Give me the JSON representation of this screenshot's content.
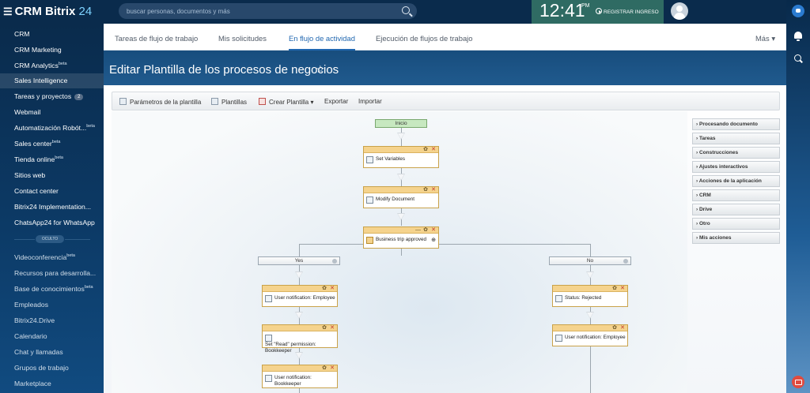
{
  "topbar": {
    "logo_text": "CRM Bitrix",
    "logo_num": "24",
    "search_placeholder": "buscar personas, documentos y más",
    "clock": "12:41",
    "ampm": "PM",
    "checkin_label": "REGISTRAR INGRESO"
  },
  "sidebar": {
    "items": [
      {
        "label": "CRM"
      },
      {
        "label": "CRM Marketing"
      },
      {
        "label": "CRM Analytics",
        "sup": "beta"
      },
      {
        "label": "Sales Intelligence"
      },
      {
        "label": "Tareas y proyectos",
        "badge": "2"
      },
      {
        "label": "Webmail"
      },
      {
        "label": "Automatización Robót...",
        "sup": "beta"
      },
      {
        "label": "Sales center",
        "sup": "beta"
      },
      {
        "label": "Tienda online",
        "sup": "beta"
      },
      {
        "label": "Sitios web"
      },
      {
        "label": "Contact center"
      },
      {
        "label": "Bitrix24 Implementation..."
      },
      {
        "label": "ChatsApp24 for WhatsApp"
      }
    ],
    "separator_label": "OCULTO",
    "hidden_items": [
      {
        "label": "Videoconferencia",
        "sup": "beta"
      },
      {
        "label": "Recursos para desarrolla..."
      },
      {
        "label": "Base de conocimientos",
        "sup": "beta"
      },
      {
        "label": "Empleados"
      },
      {
        "label": "Bitrix24.Drive"
      },
      {
        "label": "Calendario"
      },
      {
        "label": "Chat y llamadas"
      },
      {
        "label": "Grupos de trabajo"
      },
      {
        "label": "Marketplace"
      }
    ]
  },
  "tabs": [
    {
      "label": "Tareas de flujo de trabajo"
    },
    {
      "label": "Mis solicitudes"
    },
    {
      "label": "En flujo de actividad"
    },
    {
      "label": "Ejecución de flujos de trabajo"
    },
    {
      "label": "Más"
    }
  ],
  "page_title": "Editar Plantilla de los procesos de negocios",
  "toolbar": {
    "params": "Parámetros de la plantilla",
    "templates": "Plantillas",
    "create": "Crear Plantilla",
    "export": "Exportar",
    "import": "Importar"
  },
  "flow": {
    "start": "Inicio",
    "set_vars": "Set Variables",
    "modify_doc": "Modify Document",
    "condition": "Business trip approved",
    "branch_yes": "Yes",
    "branch_no": "No",
    "yes_1": "User notification: Employee",
    "yes_2": "Set \"Read\" permission: Bookkeeper",
    "yes_3": "User notification: Bookkeeper",
    "no_1": "Status: Rejected",
    "no_2": "User notification: Employee"
  },
  "activities": [
    {
      "label": "Procesando documento"
    },
    {
      "label": "Tareas"
    },
    {
      "label": "Construcciones"
    },
    {
      "label": "Ajustes interactivos"
    },
    {
      "label": "Acciones de la aplicación"
    },
    {
      "label": "CRM"
    },
    {
      "label": "Drive"
    },
    {
      "label": "Otro"
    },
    {
      "label": "Mis acciones"
    }
  ]
}
